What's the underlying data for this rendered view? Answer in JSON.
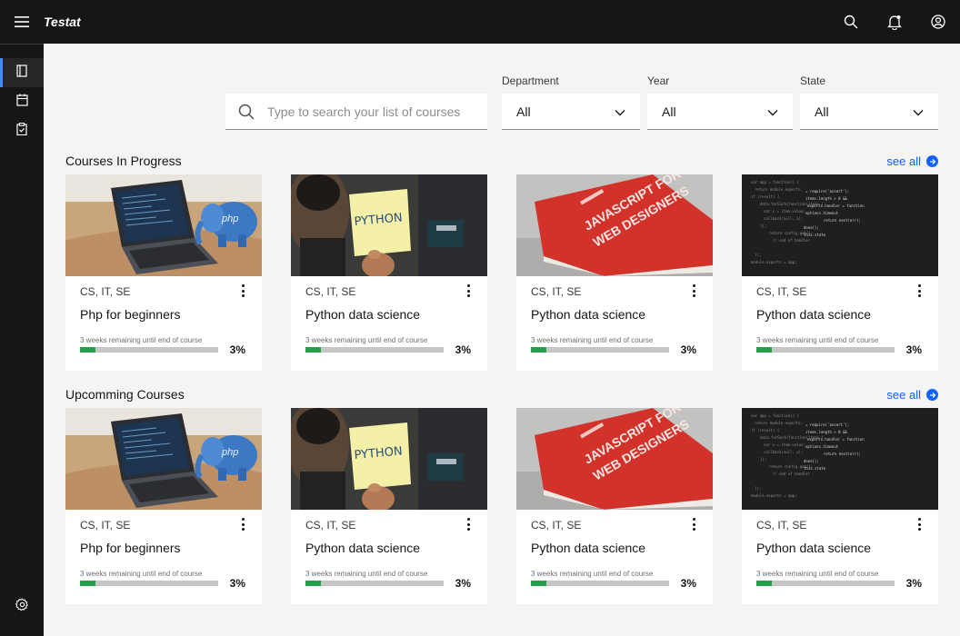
{
  "app": {
    "title": "Testat"
  },
  "filters": {
    "search_placeholder": "Type to search your list of courses",
    "department": {
      "label": "Department",
      "value": "All"
    },
    "year": {
      "label": "Year",
      "value": "All"
    },
    "state": {
      "label": "State",
      "value": "All"
    }
  },
  "sections": [
    {
      "title": "Courses In Progress",
      "see_all": "see all",
      "cards": [
        {
          "image": "laptop-php-elephant",
          "departments": "CS, IT, SE",
          "name": "Php for beginners",
          "remaining": "3 weeks remaining until end of course",
          "progress": 0.03,
          "progress_label": "3%"
        },
        {
          "image": "python-sticky-note",
          "departments": "CS, IT, SE",
          "name": "Python data science",
          "remaining": "3 weeks remaining until end of course",
          "progress": 0.03,
          "progress_label": "3%"
        },
        {
          "image": "javascript-book",
          "departments": "CS, IT, SE",
          "name": "Python data science",
          "remaining": "3 weeks remaining until end of course",
          "progress": 0.03,
          "progress_label": "3%"
        },
        {
          "image": "code-screen",
          "departments": "CS, IT, SE",
          "name": "Python data science",
          "remaining": "3 weeks remaining until end of course",
          "progress": 0.03,
          "progress_label": "3%"
        }
      ]
    },
    {
      "title": "Upcomming Courses",
      "see_all": "see all",
      "cards": [
        {
          "image": "laptop-php-elephant",
          "departments": "CS, IT, SE",
          "name": "Php for beginners",
          "remaining": "3 weeks remaining until end of course",
          "progress": 0.03,
          "progress_label": "3%"
        },
        {
          "image": "python-sticky-note",
          "departments": "CS, IT, SE",
          "name": "Python data science",
          "remaining": "3 weeks remaining until end of course",
          "progress": 0.03,
          "progress_label": "3%"
        },
        {
          "image": "javascript-book",
          "departments": "CS, IT, SE",
          "name": "Python data science",
          "remaining": "3 weeks remaining until end of course",
          "progress": 0.03,
          "progress_label": "3%"
        },
        {
          "image": "code-screen",
          "departments": "CS, IT, SE",
          "name": "Python data science",
          "remaining": "3 weeks remaining until end of course",
          "progress": 0.03,
          "progress_label": "3%"
        }
      ]
    }
  ],
  "icons": {
    "menu": "hamburger-menu-icon",
    "search": "search-icon",
    "notifications": "notification-bell-icon",
    "user": "user-avatar-icon",
    "courses": "book-icon",
    "calendar": "calendar-icon",
    "tasks": "clipboard-check-icon",
    "settings": "gear-icon"
  },
  "colors": {
    "accent": "#0f62fe",
    "progress": "#24a148",
    "header": "#161616"
  }
}
